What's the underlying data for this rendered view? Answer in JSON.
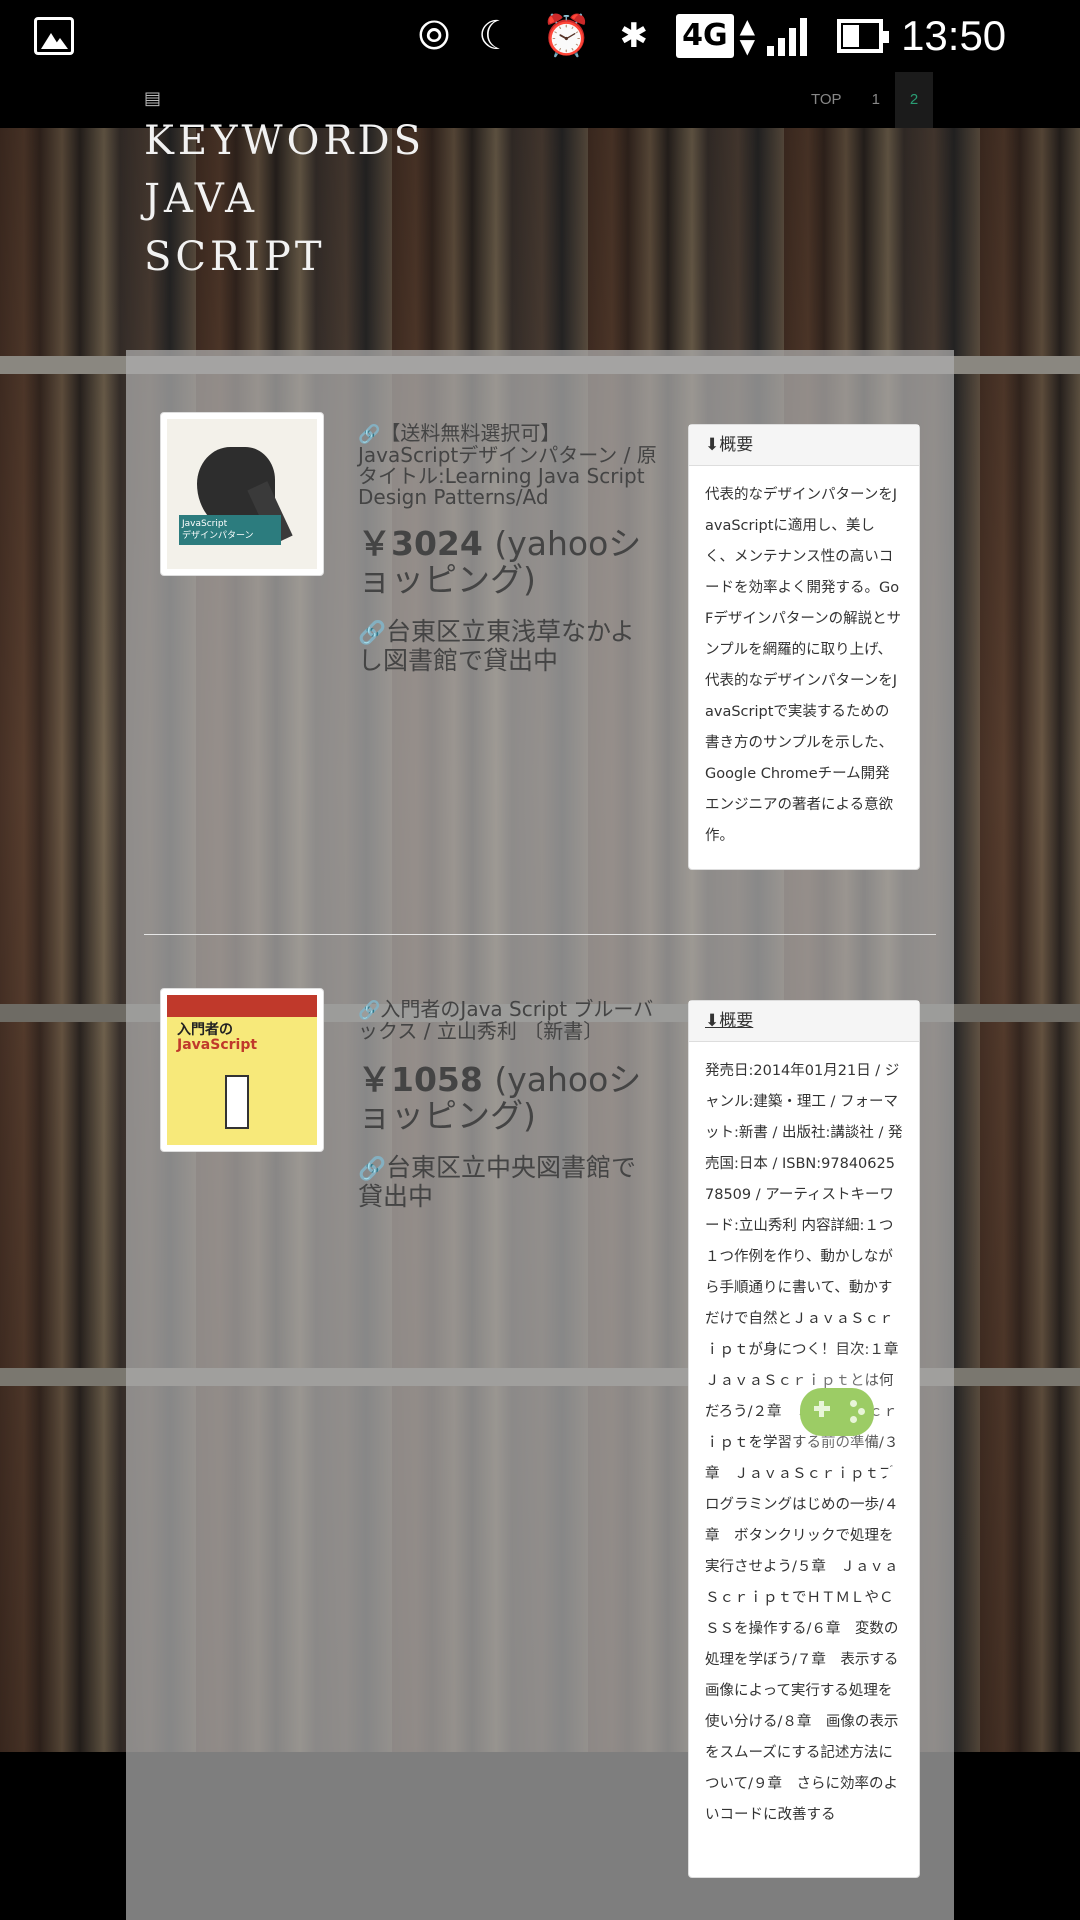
{
  "status_bar": {
    "time": "13:50",
    "network": "4G",
    "icons": [
      "gallery-icon",
      "hotspot-icon",
      "moon-icon",
      "alarm-icon",
      "bluetooth-icon",
      "data-arrows-icon",
      "signal-icon",
      "battery-icon"
    ]
  },
  "nav": {
    "book_icon": "book-icon",
    "links": [
      "TOP",
      "1",
      "2"
    ],
    "active_link": "2"
  },
  "header": {
    "keywords_lines": [
      "KEYWORDS",
      "JAVA",
      "SCRIPT"
    ]
  },
  "items": [
    {
      "title": "【送料無料選択可】JavaScriptデザインパターン / 原タイトル:Learning Java Script Design Patterns/Ad",
      "price": "￥3024",
      "price_source": "(yahooショッピング)",
      "library": "台東区立東浅草なかよし図書館で貸出中",
      "summary_heading": "⬇概要",
      "summary": "代表的なデザインパターンをJavaScriptに適用し、美しく、メンテナンス性の高いコードを効率よく開発する。GoFデザインパターンの解説とサンプルを網羅的に取り上げ、代表的なデザインパターンをJavaScriptで実装するための書き方のサンプルを示した、Google Chromeチーム開発エンジニアの著者による意欲作。"
    },
    {
      "title": "入門者のJava Script ブルーバックス / 立山秀利 〔新書〕",
      "price": "￥1058",
      "price_source": "(yahooショッピング)",
      "library": "台東区立中央図書館で貸出中",
      "summary_heading": "⬇概要",
      "summary": "発売日:2014年01月21日 / ジャンル:建築・理工 / フォーマット:新書 / 出版社:講談社 / 発売国:日本 / ISBN:9784062578509 / アーティストキーワード:立山秀利 内容詳細:１つ１つ作例を作り、動かしながら手順通りに書いて、動かすだけで自然とＪａｖａＳｃｒｉｐｔが身につく！目次:１章　ＪａｖａＳｃｒｉｐｔとは何だろう/２章　ＪａｖａＳｃｒｉｐｔを学習する前の準備/３章　ＪａｖａＳｃｒｉｐｔプログラミングはじめの一歩/４章　ボタンクリックで処理を実行させよう/５章　ＪａｖａＳｃｒｉｐｔでＨＴＭＬやＣＳＳを操作する/６章　変数の処理を学ぼう/７章　表示する画像によって実行する処理を使い分ける/８章　画像の表示をスムーズにする記述方法について/９章　さらに効率のよいコードに改善する"
    }
  ],
  "overlay": {
    "widget_icon": "gamepad-icon"
  }
}
